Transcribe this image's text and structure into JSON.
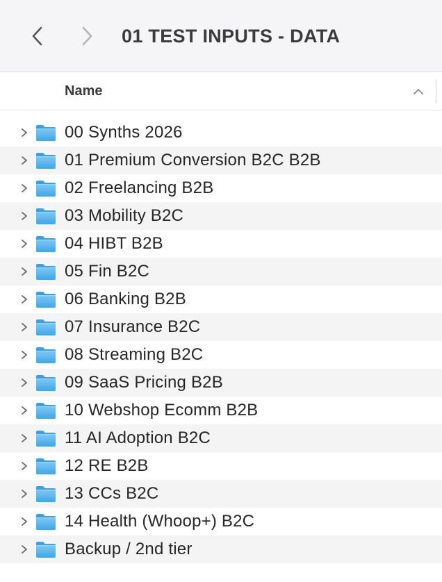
{
  "window": {
    "title": "01 TEST INPUTS - DATA"
  },
  "toolbar": {
    "back_icon": "chevron-left-icon",
    "forward_icon": "chevron-right-icon"
  },
  "columns": {
    "name_label": "Name",
    "sort_icon": "chevron-up-icon"
  },
  "colors": {
    "folder": "#5bb5ec",
    "alt_row": "#f4f4f4"
  },
  "items": [
    {
      "name": "00 Synths 2026",
      "icon": "folder-icon"
    },
    {
      "name": "01 Premium Conversion B2C B2B",
      "icon": "folder-icon"
    },
    {
      "name": "02 Freelancing B2B",
      "icon": "folder-icon"
    },
    {
      "name": "03 Mobility B2C",
      "icon": "folder-icon"
    },
    {
      "name": "04 HIBT B2B",
      "icon": "folder-icon"
    },
    {
      "name": "05 Fin B2C",
      "icon": "folder-icon"
    },
    {
      "name": "06 Banking B2B",
      "icon": "folder-icon"
    },
    {
      "name": "07 Insurance B2C",
      "icon": "folder-icon"
    },
    {
      "name": "08 Streaming B2C",
      "icon": "folder-icon"
    },
    {
      "name": "09 SaaS Pricing B2B",
      "icon": "folder-icon"
    },
    {
      "name": "10 Webshop Ecomm B2B",
      "icon": "folder-icon"
    },
    {
      "name": "11 AI Adoption B2C",
      "icon": "folder-icon"
    },
    {
      "name": "12 RE B2B",
      "icon": "folder-icon"
    },
    {
      "name": "13 CCs B2C",
      "icon": "folder-icon"
    },
    {
      "name": "14 Health (Whoop+) B2C",
      "icon": "folder-icon"
    },
    {
      "name": "Backup / 2nd tier",
      "icon": "folder-icon"
    }
  ]
}
